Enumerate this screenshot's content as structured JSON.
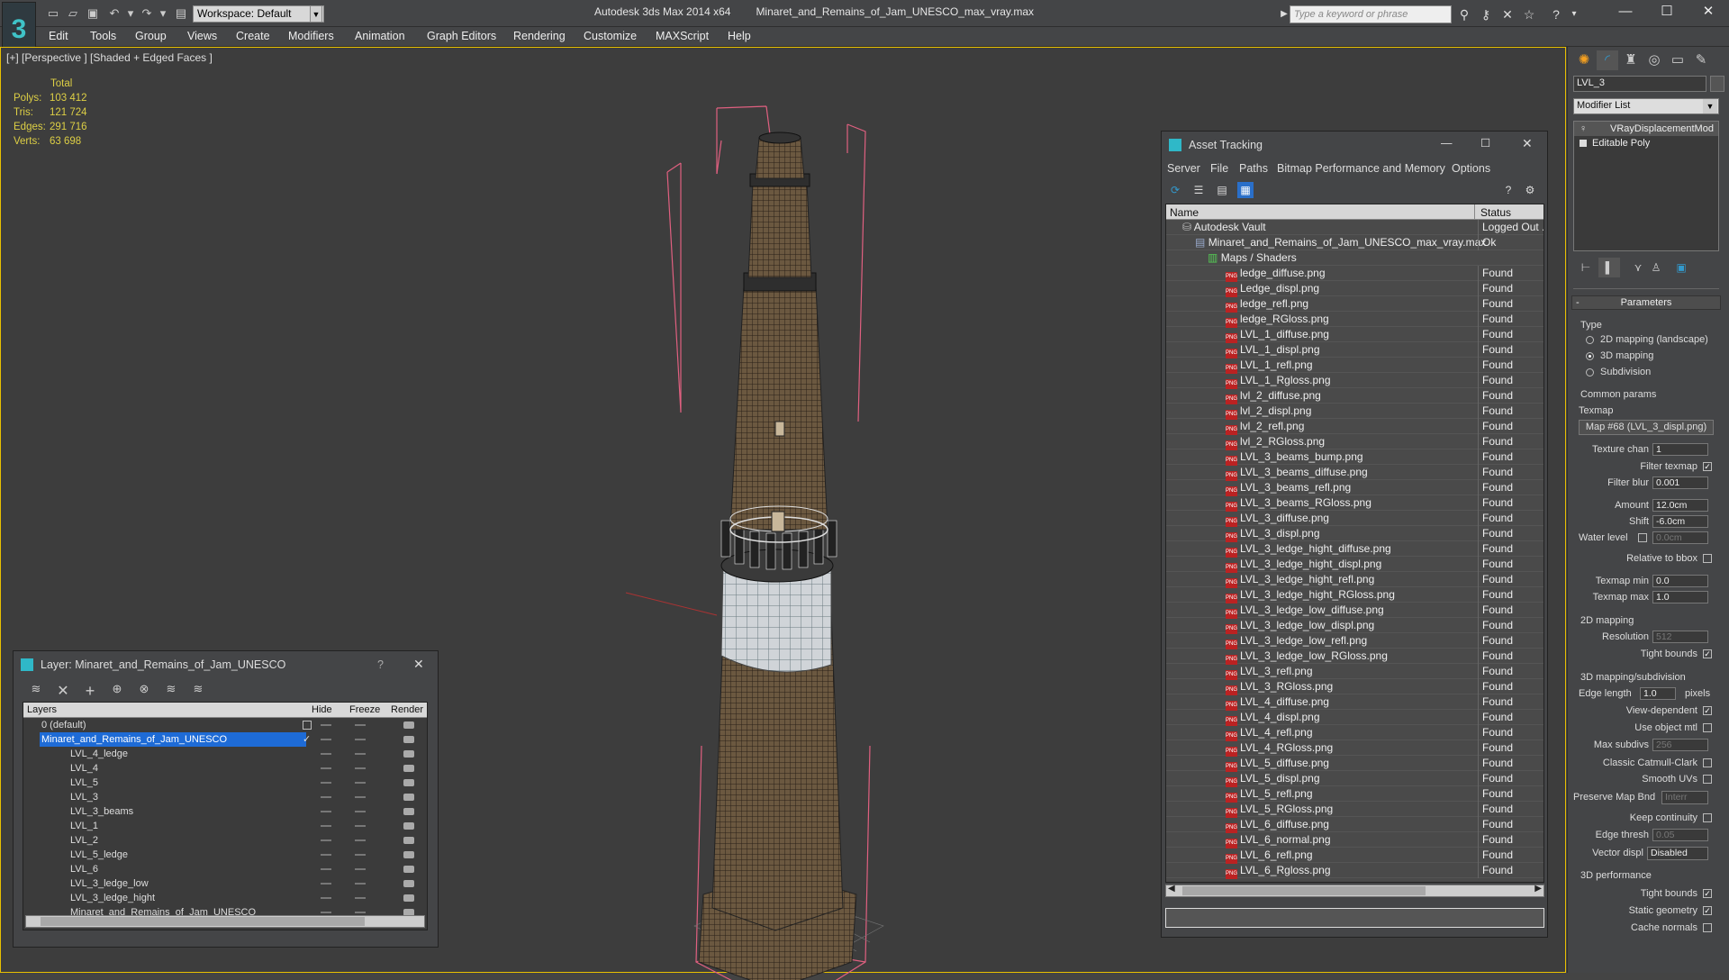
{
  "window": {
    "workspace": "Workspace: Default",
    "app_name": "Autodesk 3ds Max  2014 x64",
    "file_name": "Minaret_and_Remains_of_Jam_UNESCO_max_vray.max",
    "search_placeholder": "Type a keyword or phrase"
  },
  "menu": [
    "Edit",
    "Tools",
    "Group",
    "Views",
    "Create",
    "Modifiers",
    "Animation",
    "Graph Editors",
    "Rendering",
    "Customize",
    "MAXScript",
    "Help"
  ],
  "viewport": {
    "label": "[+] [Perspective ] [Shaded + Edged Faces ]",
    "stats_title": "Total",
    "stats": [
      {
        "label": "Polys:",
        "value": "103 412"
      },
      {
        "label": "Tris:",
        "value": "121 724"
      },
      {
        "label": "Edges:",
        "value": "291 716"
      },
      {
        "label": "Verts:",
        "value": "63 698"
      }
    ]
  },
  "layer_panel": {
    "title": "Layer: Minaret_and_Remains_of_Jam_UNESCO",
    "help": "?",
    "columns": {
      "layers": "Layers",
      "hide": "Hide",
      "freeze": "Freeze",
      "render": "Render"
    },
    "rows": [
      {
        "name": "0 (default)"
      },
      {
        "name": "Minaret_and_Remains_of_Jam_UNESCO"
      },
      {
        "name": "LVL_4_ledge"
      },
      {
        "name": "LVL_4"
      },
      {
        "name": "LVL_5"
      },
      {
        "name": "LVL_3"
      },
      {
        "name": "LVL_3_beams"
      },
      {
        "name": "LVL_1"
      },
      {
        "name": "LVL_2"
      },
      {
        "name": "LVL_5_ledge"
      },
      {
        "name": "LVL_6"
      },
      {
        "name": "LVL_3_ledge_low"
      },
      {
        "name": "LVL_3_ledge_hight"
      },
      {
        "name": "Minaret_and_Remains_of_Jam_UNESCO"
      }
    ]
  },
  "asset_panel": {
    "title": "Asset Tracking",
    "menu": [
      "Server",
      "File",
      "Paths",
      "Bitmap Performance and Memory",
      "Options"
    ],
    "columns": {
      "name": "Name",
      "status": "Status"
    },
    "vault": {
      "name": "Autodesk Vault",
      "status": "Logged Out ..."
    },
    "file": {
      "name": "Minaret_and_Remains_of_Jam_UNESCO_max_vray.max",
      "status": "Ok"
    },
    "maps_group": "Maps / Shaders",
    "maps": [
      {
        "name": "ledge_diffuse.png",
        "status": "Found"
      },
      {
        "name": "Ledge_displ.png",
        "status": "Found"
      },
      {
        "name": "ledge_refl.png",
        "status": "Found"
      },
      {
        "name": "ledge_RGloss.png",
        "status": "Found"
      },
      {
        "name": "LVL_1_diffuse.png",
        "status": "Found"
      },
      {
        "name": "LVL_1_displ.png",
        "status": "Found"
      },
      {
        "name": "LVL_1_refl.png",
        "status": "Found"
      },
      {
        "name": "LVL_1_Rgloss.png",
        "status": "Found"
      },
      {
        "name": "lvl_2_diffuse.png",
        "status": "Found"
      },
      {
        "name": "lvl_2_displ.png",
        "status": "Found"
      },
      {
        "name": "lvl_2_refl.png",
        "status": "Found"
      },
      {
        "name": "lvl_2_RGloss.png",
        "status": "Found"
      },
      {
        "name": "LVL_3_beams_bump.png",
        "status": "Found"
      },
      {
        "name": "LVL_3_beams_diffuse.png",
        "status": "Found"
      },
      {
        "name": "LVL_3_beams_refl.png",
        "status": "Found"
      },
      {
        "name": "LVL_3_beams_RGloss.png",
        "status": "Found"
      },
      {
        "name": "LVL_3_diffuse.png",
        "status": "Found"
      },
      {
        "name": "LVL_3_displ.png",
        "status": "Found"
      },
      {
        "name": "LVL_3_ledge_hight_diffuse.png",
        "status": "Found"
      },
      {
        "name": "LVL_3_ledge_hight_displ.png",
        "status": "Found"
      },
      {
        "name": "LVL_3_ledge_hight_refl.png",
        "status": "Found"
      },
      {
        "name": "LVL_3_ledge_hight_RGloss.png",
        "status": "Found"
      },
      {
        "name": "LVL_3_ledge_low_diffuse.png",
        "status": "Found"
      },
      {
        "name": "LVL_3_ledge_low_displ.png",
        "status": "Found"
      },
      {
        "name": "LVL_3_ledge_low_refl.png",
        "status": "Found"
      },
      {
        "name": "LVL_3_ledge_low_RGloss.png",
        "status": "Found"
      },
      {
        "name": "LVL_3_refl.png",
        "status": "Found"
      },
      {
        "name": "LVL_3_RGloss.png",
        "status": "Found"
      },
      {
        "name": "LVL_4_diffuse.png",
        "status": "Found"
      },
      {
        "name": "LVL_4_displ.png",
        "status": "Found"
      },
      {
        "name": "LVL_4_refl.png",
        "status": "Found"
      },
      {
        "name": "LVL_4_RGloss.png",
        "status": "Found"
      },
      {
        "name": "LVL_5_diffuse.png",
        "status": "Found"
      },
      {
        "name": "LVL_5_displ.png",
        "status": "Found"
      },
      {
        "name": "LVL_5_refl.png",
        "status": "Found"
      },
      {
        "name": "LVL_5_RGloss.png",
        "status": "Found"
      },
      {
        "name": "LVL_6_diffuse.png",
        "status": "Found"
      },
      {
        "name": "LVL_6_normal.png",
        "status": "Found"
      },
      {
        "name": "LVL_6_refl.png",
        "status": "Found"
      },
      {
        "name": "LVL_6_Rgloss.png",
        "status": "Found"
      }
    ]
  },
  "command_panel": {
    "object_name": "LVL_3",
    "modifier_list": "Modifier List",
    "stack": [
      "VRayDisplacementMod",
      "Editable Poly"
    ],
    "parameters": "Parameters",
    "type_label": "Type",
    "type_options": [
      "2D mapping (landscape)",
      "3D mapping",
      "Subdivision"
    ],
    "type_selected": 1,
    "common_params": "Common params",
    "texmap_label": "Texmap",
    "texmap_value": "Map #68 (LVL_3_displ.png)",
    "texture_chan_label": "Texture chan",
    "texture_chan": "1",
    "filter_texmap": "Filter texmap",
    "filter_blur_label": "Filter blur",
    "filter_blur": "0.001",
    "amount_label": "Amount",
    "amount": "12.0cm",
    "shift_label": "Shift",
    "shift": "-6.0cm",
    "water_level_label": "Water level",
    "water_level": "0.0cm",
    "relative_bbox": "Relative to bbox",
    "texmap_min_label": "Texmap min",
    "texmap_min": "0.0",
    "texmap_max_label": "Texmap max",
    "texmap_max": "1.0",
    "mapping2d": "2D mapping",
    "resolution_label": "Resolution",
    "resolution": "512",
    "tight_bounds": "Tight bounds",
    "mapping3d": "3D mapping/subdivision",
    "edge_length_label": "Edge length",
    "edge_length": "1.0",
    "pixels": "pixels",
    "view_dependent": "View-dependent",
    "use_object_mtl": "Use object mtl",
    "max_subdivs_label": "Max subdivs",
    "max_subdivs": "256",
    "classic_catmull": "Classic Catmull-Clark",
    "smooth_uvs": "Smooth UVs",
    "preserve_map_bnd": "Preserve Map Bnd",
    "preserve_map_value": "Interr",
    "keep_continuity": "Keep continuity",
    "edge_thresh_label": "Edge thresh",
    "edge_thresh": "0.05",
    "vector_displ_label": "Vector displ",
    "vector_displ": "Disabled",
    "perf3d": "3D performance",
    "tight_bounds2": "Tight bounds",
    "static_geometry": "Static geometry",
    "cache_normals": "Cache normals"
  }
}
